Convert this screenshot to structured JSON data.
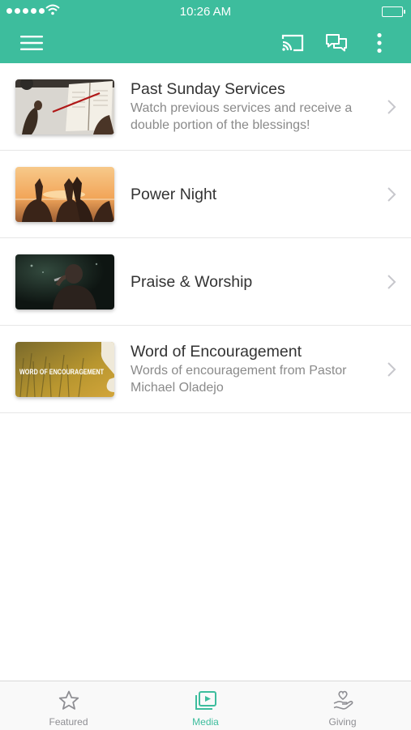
{
  "status_bar": {
    "time": "10:26 AM"
  },
  "nav": {
    "menu_icon": "hamburger-icon",
    "cast_icon": "cast-icon",
    "chat_icon": "chat-bubbles-icon",
    "more_icon": "more-vertical-icon"
  },
  "colors": {
    "accent": "#3dbd9d",
    "title": "#333333",
    "subtitle": "#8a8a8a"
  },
  "media_list": [
    {
      "title": "Past Sunday Services",
      "subtitle": "Watch previous services and receive a double portion of the blessings!",
      "thumb": "bible-reading-photo"
    },
    {
      "title": "Power Night",
      "subtitle": "",
      "thumb": "heart-hands-sunset-photo"
    },
    {
      "title": "Praise & Worship",
      "subtitle": "",
      "thumb": "worship-singer-photo"
    },
    {
      "title": "Word of Encouragement",
      "subtitle": "Words of encouragement from Pastor Michael Oladejo",
      "thumb": "word-of-encouragement-graphic",
      "thumb_text": "WORD OF ENCOURAGEMENT"
    }
  ],
  "tabs": [
    {
      "label": "Featured",
      "icon": "star-icon",
      "active": false
    },
    {
      "label": "Media",
      "icon": "media-play-icon",
      "active": true
    },
    {
      "label": "Giving",
      "icon": "giving-hand-heart-icon",
      "active": false
    }
  ]
}
